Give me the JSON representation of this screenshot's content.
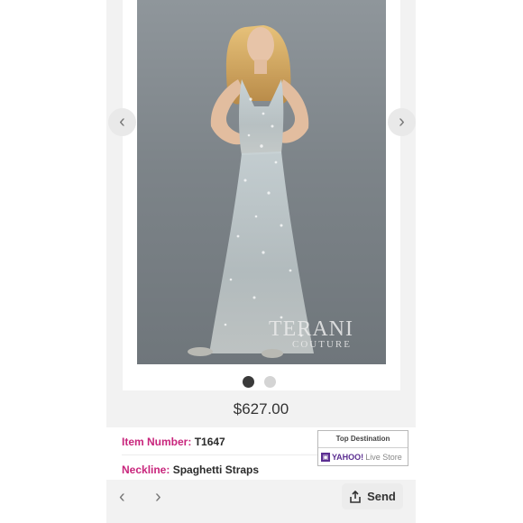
{
  "gallery": {
    "brand": "TERANI",
    "brand_sub": "COUTURE",
    "prev_icon": "chevron-left-icon",
    "next_icon": "chevron-right-icon",
    "pages": 2,
    "current_page": 1
  },
  "product": {
    "price": "$627.00",
    "item_number_label": "Item Number:",
    "item_number": "T1647",
    "neckline_label": "Neckline:",
    "neckline": "Spaghetti Straps"
  },
  "badge": {
    "title": "Top Destination",
    "yahoo": "YAHOO!",
    "store": "Live Store"
  },
  "toolbar": {
    "back_icon": "chevron-left-icon",
    "forward_icon": "chevron-right-icon",
    "send_label": "Send",
    "send_icon": "share-icon"
  },
  "colors": {
    "label_accent": "#c8257c",
    "yahoo_purple": "#5b2e91",
    "dot_active": "#3a3a3a",
    "dot_inactive": "#d4d4d4"
  }
}
